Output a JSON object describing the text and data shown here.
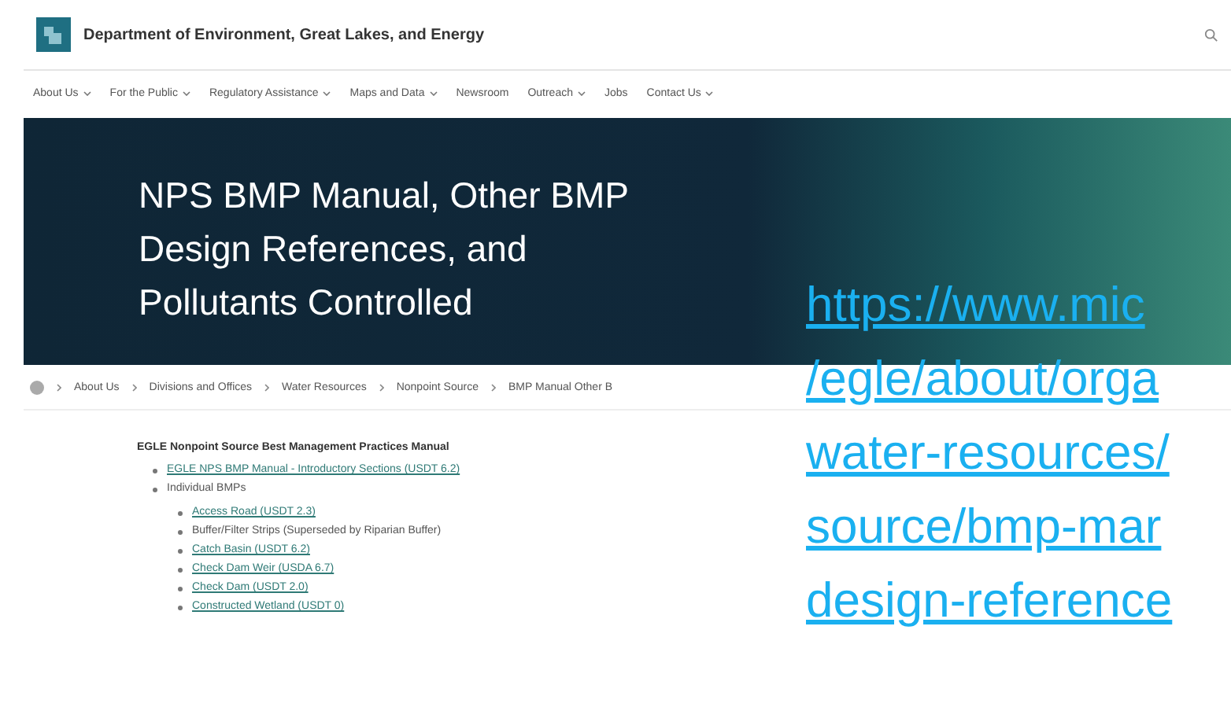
{
  "site_header": {
    "title": "Department of Environment, Great Lakes, and Energy"
  },
  "nav": [
    {
      "label": "About Us",
      "dropdown": true
    },
    {
      "label": "For the Public",
      "dropdown": true
    },
    {
      "label": "Regulatory Assistance",
      "dropdown": true
    },
    {
      "label": "Maps and Data",
      "dropdown": true
    },
    {
      "label": "Newsroom",
      "dropdown": false
    },
    {
      "label": "Outreach",
      "dropdown": true
    },
    {
      "label": "Jobs",
      "dropdown": false
    },
    {
      "label": "Contact Us",
      "dropdown": true
    }
  ],
  "hero": {
    "title_lines": [
      "NPS BMP Manual, Other BMP",
      "Design References, and",
      "Pollutants Controlled"
    ]
  },
  "breadcrumbs": [
    "About Us",
    "Divisions and Offices",
    "Water Resources",
    "Nonpoint Source",
    "BMP Manual Other B"
  ],
  "content": {
    "heading": "EGLE Nonpoint Source Best Management Practices Manual",
    "items": [
      {
        "text": "EGLE NPS BMP Manual - Introductory Sections (USDT 6.2)",
        "kind": "link"
      },
      {
        "text": "Individual BMPs",
        "kind": "text",
        "children": [
          {
            "text": "Access Road (USDT 2.3)",
            "kind": "link"
          },
          {
            "text": "Buffer/Filter Strips (Superseded by Riparian Buffer)",
            "kind": "text"
          },
          {
            "text": "Catch Basin (USDT 6.2)",
            "kind": "link"
          },
          {
            "text": "Check Dam Weir (USDA 6.7)",
            "kind": "link"
          },
          {
            "text": "Check Dam (USDT 2.0)",
            "kind": "link"
          },
          {
            "text": "Constructed Wetland (USDT 0)",
            "kind": "link"
          }
        ]
      }
    ]
  },
  "link_overlay": {
    "lines": [
      "https://www.mic",
      "/egle/about/orga",
      "water-resources/",
      "source/bmp-mar",
      "design-reference"
    ]
  }
}
